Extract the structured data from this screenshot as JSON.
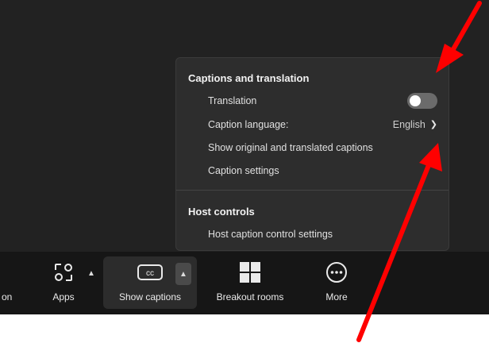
{
  "popup": {
    "captions_section_title": "Captions and translation",
    "items": [
      {
        "label": "Translation"
      },
      {
        "label": "Caption language:",
        "value": "English"
      },
      {
        "label": "Show original and translated captions"
      },
      {
        "label": "Caption settings"
      }
    ],
    "translation_toggle": "off",
    "host_section_title": "Host controls",
    "host_items": [
      {
        "label": "Host caption control settings"
      }
    ]
  },
  "toolbar": {
    "left_cut_label": "on",
    "apps_label": "Apps",
    "show_captions_label": "Show captions",
    "cc_icon_text": "cc",
    "breakout_label": "Breakout rooms",
    "more_label": "More"
  },
  "icons": {
    "apps": "apps-icon",
    "captions": "closed-captions-icon",
    "breakout": "breakout-rooms-icon",
    "more": "more-dots-icon",
    "chevron_up": "chevron-up-icon",
    "chevron_right": "chevron-right-icon"
  },
  "colors": {
    "annotation_arrow": "#ff0000",
    "toolbar_bg": "#161616",
    "popup_bg": "#2d2d2d"
  }
}
